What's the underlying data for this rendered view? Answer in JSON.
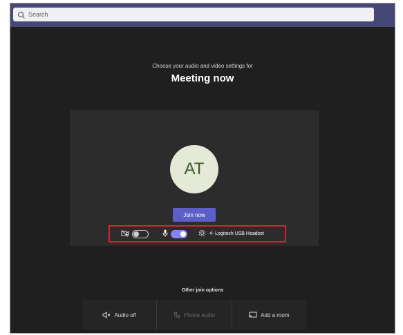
{
  "search": {
    "placeholder": "Search"
  },
  "prejoin": {
    "intro_text": "Choose your audio and video settings for",
    "meeting_title": "Meeting now"
  },
  "preview": {
    "avatar_initials": "AT",
    "join_label": "Join now",
    "camera_on": false,
    "mic_on": true,
    "audio_device_label": "4- Logitech USB Headset"
  },
  "other_options": {
    "title": "Other join options",
    "items": [
      {
        "label": "Audio off",
        "icon": "speaker-off-icon",
        "enabled": true
      },
      {
        "label": "Phone audio",
        "icon": "phone-icon",
        "enabled": false
      },
      {
        "label": "Add a room",
        "icon": "cast-room-icon",
        "enabled": true
      }
    ]
  },
  "colors": {
    "app_bar": "#464775",
    "background": "#201f1f",
    "accent": "#5b5fc7",
    "highlight_box": "#d9232e"
  }
}
